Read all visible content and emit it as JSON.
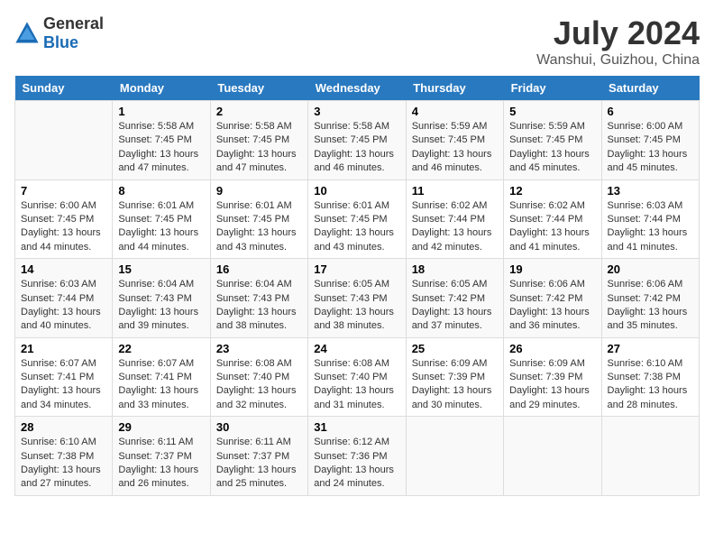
{
  "header": {
    "logo_general": "General",
    "logo_blue": "Blue",
    "title": "July 2024",
    "subtitle": "Wanshui, Guizhou, China"
  },
  "weekdays": [
    "Sunday",
    "Monday",
    "Tuesday",
    "Wednesday",
    "Thursday",
    "Friday",
    "Saturday"
  ],
  "weeks": [
    [
      {
        "day": "",
        "sunrise": "",
        "sunset": "",
        "daylight": ""
      },
      {
        "day": "1",
        "sunrise": "Sunrise: 5:58 AM",
        "sunset": "Sunset: 7:45 PM",
        "daylight": "Daylight: 13 hours and 47 minutes."
      },
      {
        "day": "2",
        "sunrise": "Sunrise: 5:58 AM",
        "sunset": "Sunset: 7:45 PM",
        "daylight": "Daylight: 13 hours and 47 minutes."
      },
      {
        "day": "3",
        "sunrise": "Sunrise: 5:58 AM",
        "sunset": "Sunset: 7:45 PM",
        "daylight": "Daylight: 13 hours and 46 minutes."
      },
      {
        "day": "4",
        "sunrise": "Sunrise: 5:59 AM",
        "sunset": "Sunset: 7:45 PM",
        "daylight": "Daylight: 13 hours and 46 minutes."
      },
      {
        "day": "5",
        "sunrise": "Sunrise: 5:59 AM",
        "sunset": "Sunset: 7:45 PM",
        "daylight": "Daylight: 13 hours and 45 minutes."
      },
      {
        "day": "6",
        "sunrise": "Sunrise: 6:00 AM",
        "sunset": "Sunset: 7:45 PM",
        "daylight": "Daylight: 13 hours and 45 minutes."
      }
    ],
    [
      {
        "day": "7",
        "sunrise": "Sunrise: 6:00 AM",
        "sunset": "Sunset: 7:45 PM",
        "daylight": "Daylight: 13 hours and 44 minutes."
      },
      {
        "day": "8",
        "sunrise": "Sunrise: 6:01 AM",
        "sunset": "Sunset: 7:45 PM",
        "daylight": "Daylight: 13 hours and 44 minutes."
      },
      {
        "day": "9",
        "sunrise": "Sunrise: 6:01 AM",
        "sunset": "Sunset: 7:45 PM",
        "daylight": "Daylight: 13 hours and 43 minutes."
      },
      {
        "day": "10",
        "sunrise": "Sunrise: 6:01 AM",
        "sunset": "Sunset: 7:45 PM",
        "daylight": "Daylight: 13 hours and 43 minutes."
      },
      {
        "day": "11",
        "sunrise": "Sunrise: 6:02 AM",
        "sunset": "Sunset: 7:44 PM",
        "daylight": "Daylight: 13 hours and 42 minutes."
      },
      {
        "day": "12",
        "sunrise": "Sunrise: 6:02 AM",
        "sunset": "Sunset: 7:44 PM",
        "daylight": "Daylight: 13 hours and 41 minutes."
      },
      {
        "day": "13",
        "sunrise": "Sunrise: 6:03 AM",
        "sunset": "Sunset: 7:44 PM",
        "daylight": "Daylight: 13 hours and 41 minutes."
      }
    ],
    [
      {
        "day": "14",
        "sunrise": "Sunrise: 6:03 AM",
        "sunset": "Sunset: 7:44 PM",
        "daylight": "Daylight: 13 hours and 40 minutes."
      },
      {
        "day": "15",
        "sunrise": "Sunrise: 6:04 AM",
        "sunset": "Sunset: 7:43 PM",
        "daylight": "Daylight: 13 hours and 39 minutes."
      },
      {
        "day": "16",
        "sunrise": "Sunrise: 6:04 AM",
        "sunset": "Sunset: 7:43 PM",
        "daylight": "Daylight: 13 hours and 38 minutes."
      },
      {
        "day": "17",
        "sunrise": "Sunrise: 6:05 AM",
        "sunset": "Sunset: 7:43 PM",
        "daylight": "Daylight: 13 hours and 38 minutes."
      },
      {
        "day": "18",
        "sunrise": "Sunrise: 6:05 AM",
        "sunset": "Sunset: 7:42 PM",
        "daylight": "Daylight: 13 hours and 37 minutes."
      },
      {
        "day": "19",
        "sunrise": "Sunrise: 6:06 AM",
        "sunset": "Sunset: 7:42 PM",
        "daylight": "Daylight: 13 hours and 36 minutes."
      },
      {
        "day": "20",
        "sunrise": "Sunrise: 6:06 AM",
        "sunset": "Sunset: 7:42 PM",
        "daylight": "Daylight: 13 hours and 35 minutes."
      }
    ],
    [
      {
        "day": "21",
        "sunrise": "Sunrise: 6:07 AM",
        "sunset": "Sunset: 7:41 PM",
        "daylight": "Daylight: 13 hours and 34 minutes."
      },
      {
        "day": "22",
        "sunrise": "Sunrise: 6:07 AM",
        "sunset": "Sunset: 7:41 PM",
        "daylight": "Daylight: 13 hours and 33 minutes."
      },
      {
        "day": "23",
        "sunrise": "Sunrise: 6:08 AM",
        "sunset": "Sunset: 7:40 PM",
        "daylight": "Daylight: 13 hours and 32 minutes."
      },
      {
        "day": "24",
        "sunrise": "Sunrise: 6:08 AM",
        "sunset": "Sunset: 7:40 PM",
        "daylight": "Daylight: 13 hours and 31 minutes."
      },
      {
        "day": "25",
        "sunrise": "Sunrise: 6:09 AM",
        "sunset": "Sunset: 7:39 PM",
        "daylight": "Daylight: 13 hours and 30 minutes."
      },
      {
        "day": "26",
        "sunrise": "Sunrise: 6:09 AM",
        "sunset": "Sunset: 7:39 PM",
        "daylight": "Daylight: 13 hours and 29 minutes."
      },
      {
        "day": "27",
        "sunrise": "Sunrise: 6:10 AM",
        "sunset": "Sunset: 7:38 PM",
        "daylight": "Daylight: 13 hours and 28 minutes."
      }
    ],
    [
      {
        "day": "28",
        "sunrise": "Sunrise: 6:10 AM",
        "sunset": "Sunset: 7:38 PM",
        "daylight": "Daylight: 13 hours and 27 minutes."
      },
      {
        "day": "29",
        "sunrise": "Sunrise: 6:11 AM",
        "sunset": "Sunset: 7:37 PM",
        "daylight": "Daylight: 13 hours and 26 minutes."
      },
      {
        "day": "30",
        "sunrise": "Sunrise: 6:11 AM",
        "sunset": "Sunset: 7:37 PM",
        "daylight": "Daylight: 13 hours and 25 minutes."
      },
      {
        "day": "31",
        "sunrise": "Sunrise: 6:12 AM",
        "sunset": "Sunset: 7:36 PM",
        "daylight": "Daylight: 13 hours and 24 minutes."
      },
      {
        "day": "",
        "sunrise": "",
        "sunset": "",
        "daylight": ""
      },
      {
        "day": "",
        "sunrise": "",
        "sunset": "",
        "daylight": ""
      },
      {
        "day": "",
        "sunrise": "",
        "sunset": "",
        "daylight": ""
      }
    ]
  ]
}
